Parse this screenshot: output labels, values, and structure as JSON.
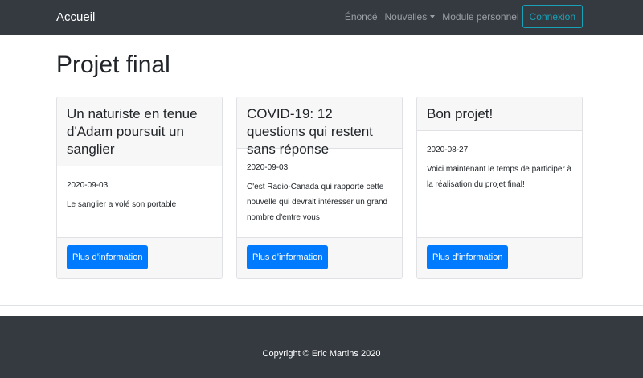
{
  "navbar": {
    "brand": "Accueil",
    "links": [
      "Énoncé",
      "Nouvelles",
      "Module personnel"
    ],
    "login_button": "Connexion"
  },
  "page": {
    "title": "Projet final"
  },
  "cards": [
    {
      "title": "Un naturiste en tenue d'Adam poursuit un sanglier",
      "date": "2020-09-03",
      "text": "Le sanglier a volé son portable",
      "button": "Plus d’information"
    },
    {
      "title": "COVID-19: 12 questions qui restent sans réponse",
      "date": "2020-09-03",
      "text": "C'est Radio-Canada qui rapporte cette nouvelle qui devrait intéresser un grand nombre d'entre vous",
      "button": "Plus d’information"
    },
    {
      "title": "Bon projet!",
      "date": "2020-08-27",
      "text": "Voici maintenant le temps de participer à la réalisation du projet final!",
      "button": "Plus d’information"
    }
  ],
  "footer": {
    "copyright": "Copyright © Eric Martins 2020"
  },
  "colors": {
    "navbar_bg": "#343a40",
    "primary": "#007bff",
    "info": "#17a2b8",
    "card_header_bg": "#f7f7f7"
  }
}
